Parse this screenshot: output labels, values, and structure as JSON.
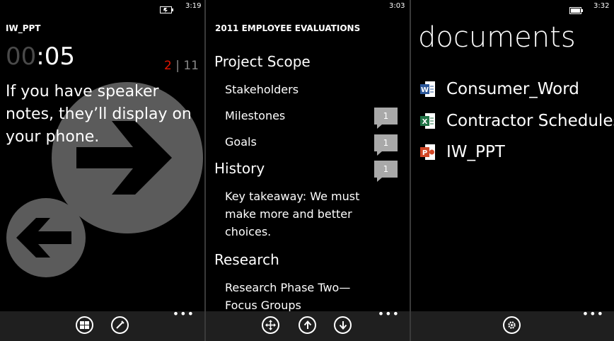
{
  "panels": {
    "presenter": {
      "status_time": "3:19",
      "app_title": "IW_PPT",
      "timer_dim": "00",
      "timer_rest": ":05",
      "slide_current": "2",
      "slide_separator": "|",
      "slide_total": "11",
      "notes_text": "If you have speaker notes, they’ll display on your phone.",
      "appbar": {
        "buttons": [
          "slides-grid-icon",
          "pen-icon"
        ],
        "more": "•••"
      }
    },
    "outline": {
      "status_time": "3:03",
      "header": "2011 EMPLOYEE EVALUATIONS",
      "sections": [
        {
          "title": "Project Scope",
          "items": [
            {
              "label": "Stakeholders",
              "comments": null
            },
            {
              "label": "Milestones",
              "comments": "1"
            },
            {
              "label": "Goals",
              "comments": "1"
            }
          ]
        },
        {
          "title": "History",
          "comments": "1",
          "items": [
            {
              "label": "Key takeaway: We must make more and better choices."
            }
          ]
        },
        {
          "title": "Research",
          "items": [
            {
              "label": "Research Phase Two—Focus Groups"
            }
          ]
        }
      ],
      "appbar": {
        "buttons": [
          "move-icon",
          "arrow-up-icon",
          "arrow-down-icon"
        ],
        "more": "•••"
      }
    },
    "documents": {
      "status_time": "3:32",
      "title": "documents",
      "files": [
        {
          "name": "Consumer_Word",
          "type": "word",
          "color": "#2b579a",
          "letter": "W"
        },
        {
          "name": "Contractor Schedules",
          "type": "excel",
          "color": "#217346",
          "letter": "X"
        },
        {
          "name": "IW_PPT",
          "type": "powerpoint",
          "color": "#d24726",
          "letter": "P"
        }
      ],
      "appbar": {
        "buttons": [
          "settings-icon"
        ],
        "more": "•••"
      }
    }
  },
  "colors": {
    "accent_red": "#e51400",
    "appbar": "#1f1f1f",
    "comment_badge": "#a9a9a9"
  }
}
